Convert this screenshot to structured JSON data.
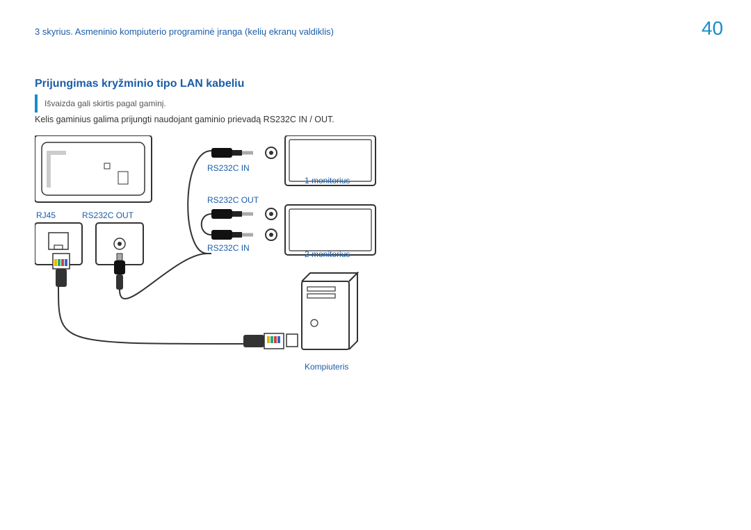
{
  "header": {
    "chapter": "3 skyrius. Asmeninio kompiuterio programinė įranga (kelių ekranų valdiklis)",
    "page_number": "40"
  },
  "section": {
    "title": "Prijungimas kryžminio tipo LAN kabeliu",
    "note": "Išvaizda gali skirtis pagal gaminį.",
    "body": "Kelis gaminius galima prijungti naudojant gaminio prievadą RS232C IN / OUT."
  },
  "labels": {
    "rj45": "RJ45",
    "rs232c_out": "RS232C OUT",
    "rs232c_in_1": "RS232C IN",
    "rs232c_out_2": "RS232C OUT",
    "rs232c_in_2": "RS232C IN",
    "monitor1": "1 monitorius",
    "monitor2": "2 monitorius",
    "computer": "Kompiuteris"
  }
}
